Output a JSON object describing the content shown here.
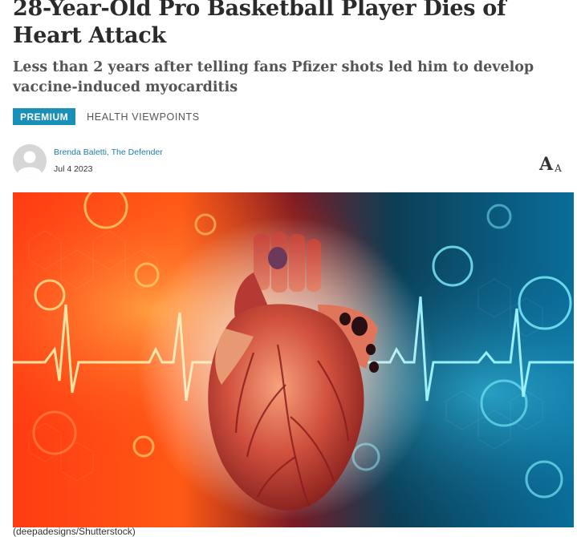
{
  "article": {
    "title": "28-Year-Old Pro Basketball Player Dies of Heart Attack",
    "subtitle": "Less than 2 years after telling fans Pfizer shots led him to develop vaccine-induced myocarditis",
    "badge": "PREMIUM",
    "category": "HEALTH VIEWPOINTS",
    "author": "Brenda Baletti, The Defender",
    "date": "Jul 4 2023",
    "font_size_big": "A",
    "font_size_small": "A",
    "image_caption": "(deepadesigns/Shutterstock)"
  },
  "colors": {
    "accent": "#1a8fb8",
    "author_link": "#1a7fa8",
    "title": "#2b2b2b"
  },
  "icons": {
    "avatar": "user-avatar-icon",
    "font_size": "font-size-icon"
  }
}
